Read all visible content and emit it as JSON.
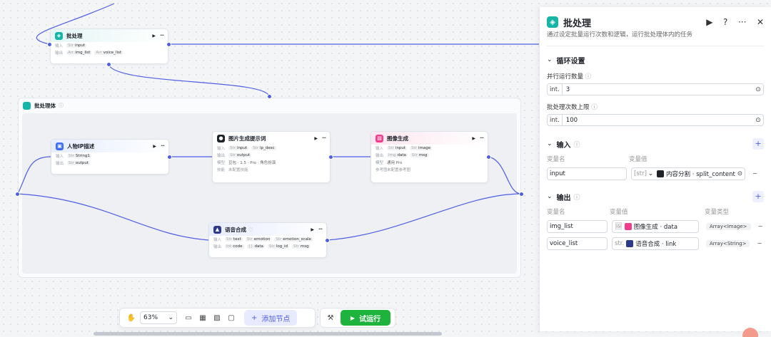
{
  "nodes": {
    "batch": {
      "title": "批处理",
      "in_label": "输入",
      "in_tags": [
        {
          "t": "Str",
          "n": "input"
        }
      ],
      "out_label": "输出",
      "out_tags": [
        {
          "t": "Arr",
          "n": "img_list"
        },
        {
          "t": "Arr",
          "n": "voice_list"
        }
      ]
    },
    "group": {
      "title": "批处理体",
      "info": "ⓘ"
    },
    "persona": {
      "title": "人物IP描述",
      "in_label": "输入",
      "in_tags": [
        {
          "t": "Str",
          "n": "String1"
        }
      ],
      "out_label": "输出",
      "out_tags": [
        {
          "t": "Str",
          "n": "output"
        }
      ]
    },
    "prompt": {
      "title": "图片生成提示词",
      "in_label": "输入",
      "in_tags": [
        {
          "t": "Str",
          "n": "input"
        },
        {
          "t": "Str",
          "n": "ip_desc"
        }
      ],
      "out_label": "输出",
      "out_tags": [
        {
          "t": "Str",
          "n": "output"
        }
      ],
      "model_label": "模型",
      "model_value": "豆包 · 1.5 · Pro · 角色扮演",
      "skill_label": "技能",
      "skill_value": "未配置技能"
    },
    "image": {
      "title": "图像生成",
      "in_label": "输入",
      "in_tags": [
        {
          "t": "Str",
          "n": "input"
        },
        {
          "t": "Str",
          "n": "image"
        }
      ],
      "out_label": "输出",
      "out_tags": [
        {
          "t": "Img",
          "n": "data"
        },
        {
          "t": "Str",
          "n": "msg"
        }
      ],
      "model_label": "模型",
      "model_value": "通用 Pro",
      "ref_label": "参考图",
      "ref_value": "未配置参考图"
    },
    "tts": {
      "title": "语音合成",
      "badge": "♡",
      "in_label": "输入",
      "in_tags": [
        {
          "t": "Str",
          "n": "text"
        },
        {
          "t": "Str",
          "n": "emotion"
        },
        {
          "t": "Str",
          "n": "emotion_scale"
        }
      ],
      "out_label": "输出",
      "out_tags": [
        {
          "t": "Int",
          "n": "code"
        },
        {
          "t": "{}",
          "n": "data"
        },
        {
          "t": "Str",
          "n": "log_id"
        },
        {
          "t": "Str",
          "n": "msg"
        }
      ]
    }
  },
  "toolbar": {
    "zoom": "63%",
    "add_node": "添加节点",
    "run": "试运行"
  },
  "panel": {
    "title": "批处理",
    "description": "通过设定批量运行次数和逻辑，运行批处理体内的任务",
    "loop_section": "循环设置",
    "parallel_label": "并行运行数量",
    "parallel_type": "int.",
    "parallel_value": "3",
    "max_label": "批处理次数上限",
    "max_type": "int.",
    "max_value": "100",
    "input_section": "输入",
    "input_col_name": "变量名",
    "input_col_value": "变量值",
    "input_name": "input",
    "input_ref_type": "[str]",
    "input_ref": "内容分割 · split_content",
    "output_section": "输出",
    "output_col_name": "变量名",
    "output_col_value": "变量值",
    "output_col_type": "变量类型",
    "outputs": [
      {
        "name": "img_list",
        "prefix": "🖼",
        "ref": "图像生成 · data",
        "type": "Array<Image>"
      },
      {
        "name": "voice_list",
        "prefix": "str.",
        "ref": "语音合成 · link",
        "type": "Array<String>"
      }
    ]
  },
  "colors": {
    "accent": "#4e5ee4",
    "run_green": "#1db33c",
    "batch_teal": "#16b5a8",
    "image_pink": "#f23c8c",
    "persona_blue": "#3b6ef5"
  },
  "icons": [
    "batch-icon",
    "run-icon",
    "help-icon",
    "more-icon",
    "close-icon",
    "chevron-down-icon",
    "plus-icon",
    "minus-icon",
    "stepper-icon",
    "hand-icon",
    "comment-icon",
    "layout-icon",
    "image-icon",
    "minimap-icon",
    "wrench-icon",
    "play-icon"
  ]
}
